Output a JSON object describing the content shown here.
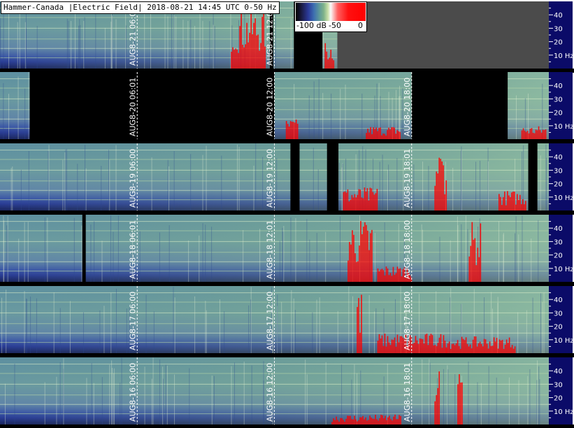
{
  "title": "Hammer-Canada |Electric Field| 2018-08-21 14:45 UTC 0-50 Hz",
  "colorbar": {
    "tick_labels": [
      "-100 dB",
      "-50",
      "0"
    ]
  },
  "chart_data": {
    "type": "heatmap",
    "title": "Hammer-Canada |Electric Field| 2018-08-21 14:45 UTC 0-50 Hz",
    "ylabel_unit": "Hz",
    "ylim": [
      0,
      50
    ],
    "y_ticks": [
      10,
      20,
      30,
      40
    ],
    "y_tick_labels": [
      "10 Hz",
      "20",
      "30",
      "40"
    ],
    "color_scale": {
      "min": -100,
      "max": 0,
      "unit": "dB",
      "labels": [
        "-100 dB",
        "-50",
        "0"
      ]
    },
    "colors": {
      "background": "#4b4b4b",
      "divider": "#000000",
      "marker_line": "#ffffff",
      "activity": "#ff0000"
    },
    "rows": [
      {
        "day": "2018-08-21",
        "markers": [
          "AUG8-21 06:01",
          "AUG8-21 12:01"
        ],
        "data_until_hour": 14.75,
        "gaps": [
          [
            11.8,
            11.95
          ],
          [
            12.85,
            14.1
          ]
        ],
        "red_bursts": [
          [
            10.1,
            11.6,
            0.9
          ],
          [
            14.2,
            14.6,
            0.4
          ]
        ]
      },
      {
        "day": "2018-08-20",
        "markers": [
          "AUG8-20 06:01",
          "AUG8-20 12:00",
          "AUG8-20 18:00"
        ],
        "data_until_hour": 24,
        "gaps": [
          [
            1.3,
            12.0
          ],
          [
            18.0,
            22.2
          ]
        ],
        "red_bursts": [
          [
            12.5,
            13.0,
            0.3
          ],
          [
            16.0,
            17.5,
            0.2
          ],
          [
            22.8,
            23.9,
            0.2
          ]
        ]
      },
      {
        "day": "2018-08-19",
        "markers": [
          "AUG8-19 06:00",
          "AUG8-19 12:00",
          "AUG8-19 18:01"
        ],
        "data_until_hour": 24,
        "gaps": [
          [
            12.7,
            13.1
          ],
          [
            14.3,
            14.8
          ],
          [
            23.1,
            23.5
          ]
        ],
        "red_bursts": [
          [
            15.0,
            16.5,
            0.35
          ],
          [
            19.0,
            19.5,
            0.95
          ],
          [
            21.8,
            23.0,
            0.3
          ]
        ]
      },
      {
        "day": "2018-08-18",
        "markers": [
          "AUG8-18 06:01",
          "AUG8-18 12:01",
          "AUG8-18 18:00"
        ],
        "data_until_hour": 24,
        "gaps": [
          [
            3.6,
            3.75
          ]
        ],
        "red_bursts": [
          [
            15.2,
            16.3,
            0.95
          ],
          [
            16.5,
            18.0,
            0.25
          ],
          [
            20.5,
            21.0,
            0.9
          ]
        ]
      },
      {
        "day": "2018-08-17",
        "markers": [
          "AUG8-17 06:00",
          "AUG8-17 12:00",
          "AUG8-17 18:00"
        ],
        "data_until_hour": 24,
        "gaps": [],
        "red_bursts": [
          [
            16.5,
            19.5,
            0.3
          ],
          [
            19.5,
            22.5,
            0.25
          ],
          [
            15.6,
            15.8,
            0.95
          ]
        ]
      },
      {
        "day": "2018-08-16",
        "markers": [
          "AUG8-16 06:00",
          "AUG8-16 12:00",
          "AUG8-16 18:01"
        ],
        "data_until_hour": 24,
        "gaps": [],
        "red_bursts": [
          [
            14.5,
            17.5,
            0.15
          ],
          [
            19.0,
            19.2,
            0.9
          ],
          [
            20.0,
            20.2,
            0.85
          ]
        ]
      }
    ]
  }
}
